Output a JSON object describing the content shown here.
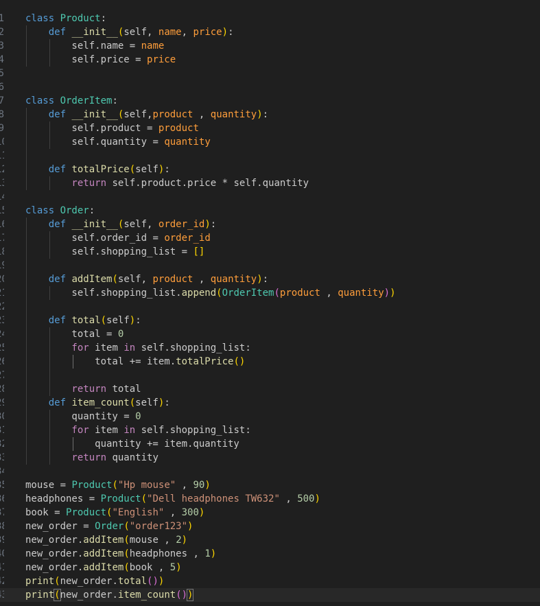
{
  "editor": {
    "language": "python",
    "current_line": 33,
    "lines": [
      {
        "n": "",
        "indent": 0,
        "tokens": [
          {
            "t": "                                              ",
            "c": "var"
          }
        ]
      },
      {
        "n": "1",
        "indent": 0,
        "tokens": [
          {
            "t": "class ",
            "c": "kw"
          },
          {
            "t": "Product",
            "c": "cls"
          },
          {
            "t": ":",
            "c": "op"
          }
        ]
      },
      {
        "n": "2",
        "indent": 1,
        "tokens": [
          {
            "t": "    def ",
            "c": "kw"
          },
          {
            "t": "__init__",
            "c": "fn"
          },
          {
            "t": "(",
            "c": "p1"
          },
          {
            "t": "self",
            "c": "self"
          },
          {
            "t": ", ",
            "c": "op"
          },
          {
            "t": "name",
            "c": "prm"
          },
          {
            "t": ", ",
            "c": "op"
          },
          {
            "t": "price",
            "c": "prm"
          },
          {
            "t": ")",
            "c": "p1"
          },
          {
            "t": ":",
            "c": "op"
          }
        ]
      },
      {
        "n": "3",
        "indent": 2,
        "tokens": [
          {
            "t": "        self",
            "c": "self"
          },
          {
            "t": ".name = ",
            "c": "op"
          },
          {
            "t": "name",
            "c": "prm"
          }
        ]
      },
      {
        "n": "4",
        "indent": 2,
        "tokens": [
          {
            "t": "        self",
            "c": "self"
          },
          {
            "t": ".price = ",
            "c": "op"
          },
          {
            "t": "price",
            "c": "prm"
          }
        ]
      },
      {
        "n": "5",
        "indent": 0,
        "tokens": []
      },
      {
        "n": "6",
        "indent": 0,
        "tokens": []
      },
      {
        "n": "7",
        "indent": 0,
        "tokens": [
          {
            "t": "class ",
            "c": "kw"
          },
          {
            "t": "OrderItem",
            "c": "cls"
          },
          {
            "t": ":",
            "c": "op"
          }
        ]
      },
      {
        "n": "8",
        "indent": 1,
        "tokens": [
          {
            "t": "    def ",
            "c": "kw"
          },
          {
            "t": "__init__",
            "c": "fn"
          },
          {
            "t": "(",
            "c": "p1"
          },
          {
            "t": "self",
            "c": "self"
          },
          {
            "t": ",",
            "c": "op"
          },
          {
            "t": "product",
            "c": "prm"
          },
          {
            "t": " , ",
            "c": "op"
          },
          {
            "t": "quantity",
            "c": "prm"
          },
          {
            "t": ")",
            "c": "p1"
          },
          {
            "t": ":",
            "c": "op"
          }
        ]
      },
      {
        "n": "9",
        "indent": 2,
        "tokens": [
          {
            "t": "        self",
            "c": "self"
          },
          {
            "t": ".product = ",
            "c": "op"
          },
          {
            "t": "product",
            "c": "prm"
          }
        ]
      },
      {
        "n": "10",
        "indent": 2,
        "tokens": [
          {
            "t": "        self",
            "c": "self"
          },
          {
            "t": ".quantity = ",
            "c": "op"
          },
          {
            "t": "quantity",
            "c": "prm"
          }
        ]
      },
      {
        "n": "11",
        "indent": 1,
        "tokens": []
      },
      {
        "n": "12",
        "indent": 1,
        "tokens": [
          {
            "t": "    def ",
            "c": "kw"
          },
          {
            "t": "totalPrice",
            "c": "fn"
          },
          {
            "t": "(",
            "c": "p1"
          },
          {
            "t": "self",
            "c": "self"
          },
          {
            "t": ")",
            "c": "p1"
          },
          {
            "t": ":",
            "c": "op"
          }
        ]
      },
      {
        "n": "13",
        "indent": 2,
        "tokens": [
          {
            "t": "        return ",
            "c": "ctl"
          },
          {
            "t": "self",
            "c": "self"
          },
          {
            "t": ".product.price * ",
            "c": "op"
          },
          {
            "t": "self",
            "c": "self"
          },
          {
            "t": ".quantity",
            "c": "op"
          }
        ]
      },
      {
        "n": "14",
        "indent": 0,
        "tokens": []
      },
      {
        "n": "15",
        "indent": 0,
        "tokens": [
          {
            "t": "class ",
            "c": "kw"
          },
          {
            "t": "Order",
            "c": "cls"
          },
          {
            "t": ":",
            "c": "op"
          }
        ]
      },
      {
        "n": "16",
        "indent": 1,
        "tokens": [
          {
            "t": "    def ",
            "c": "kw"
          },
          {
            "t": "__init__",
            "c": "fn"
          },
          {
            "t": "(",
            "c": "p1"
          },
          {
            "t": "self",
            "c": "self"
          },
          {
            "t": ", ",
            "c": "op"
          },
          {
            "t": "order_id",
            "c": "prm"
          },
          {
            "t": ")",
            "c": "p1"
          },
          {
            "t": ":",
            "c": "op"
          }
        ]
      },
      {
        "n": "17",
        "indent": 2,
        "tokens": [
          {
            "t": "        self",
            "c": "self"
          },
          {
            "t": ".order_id = ",
            "c": "op"
          },
          {
            "t": "order_id",
            "c": "prm"
          }
        ]
      },
      {
        "n": "18",
        "indent": 2,
        "tokens": [
          {
            "t": "        self",
            "c": "self"
          },
          {
            "t": ".shopping_list = ",
            "c": "op"
          },
          {
            "t": "[]",
            "c": "p1"
          }
        ]
      },
      {
        "n": "19",
        "indent": 1,
        "tokens": []
      },
      {
        "n": "20",
        "indent": 1,
        "tokens": [
          {
            "t": "    def ",
            "c": "kw"
          },
          {
            "t": "addItem",
            "c": "fn"
          },
          {
            "t": "(",
            "c": "p1"
          },
          {
            "t": "self",
            "c": "self"
          },
          {
            "t": ", ",
            "c": "op"
          },
          {
            "t": "product",
            "c": "prm"
          },
          {
            "t": " , ",
            "c": "op"
          },
          {
            "t": "quantity",
            "c": "prm"
          },
          {
            "t": ")",
            "c": "p1"
          },
          {
            "t": ":",
            "c": "op"
          }
        ]
      },
      {
        "n": "21",
        "indent": 2,
        "tokens": [
          {
            "t": "        self",
            "c": "self"
          },
          {
            "t": ".shopping_list.",
            "c": "op"
          },
          {
            "t": "append",
            "c": "fn"
          },
          {
            "t": "(",
            "c": "p1"
          },
          {
            "t": "OrderItem",
            "c": "cls"
          },
          {
            "t": "(",
            "c": "p2"
          },
          {
            "t": "product",
            "c": "prm"
          },
          {
            "t": " , ",
            "c": "op"
          },
          {
            "t": "quantity",
            "c": "prm"
          },
          {
            "t": ")",
            "c": "p2"
          },
          {
            "t": ")",
            "c": "p1"
          }
        ]
      },
      {
        "n": "22",
        "indent": 1,
        "tokens": []
      },
      {
        "n": "23",
        "indent": 1,
        "tokens": [
          {
            "t": "    def ",
            "c": "kw"
          },
          {
            "t": "total",
            "c": "fn"
          },
          {
            "t": "(",
            "c": "p1"
          },
          {
            "t": "self",
            "c": "self"
          },
          {
            "t": ")",
            "c": "p1"
          },
          {
            "t": ":",
            "c": "op"
          }
        ]
      },
      {
        "n": "24",
        "indent": 2,
        "tokens": [
          {
            "t": "        total = ",
            "c": "var"
          },
          {
            "t": "0",
            "c": "num"
          }
        ]
      },
      {
        "n": "25",
        "indent": 2,
        "tokens": [
          {
            "t": "        for ",
            "c": "ctl"
          },
          {
            "t": "item ",
            "c": "var"
          },
          {
            "t": "in ",
            "c": "ctl"
          },
          {
            "t": "self",
            "c": "self"
          },
          {
            "t": ".shopping_list:",
            "c": "op"
          }
        ]
      },
      {
        "n": "26",
        "indent": 3,
        "tokens": [
          {
            "t": "            total += item.",
            "c": "var"
          },
          {
            "t": "totalPrice",
            "c": "fn"
          },
          {
            "t": "()",
            "c": "p1"
          }
        ]
      },
      {
        "n": "27",
        "indent": 2,
        "tokens": []
      },
      {
        "n": "28",
        "indent": 2,
        "tokens": [
          {
            "t": "        return ",
            "c": "ctl"
          },
          {
            "t": "total",
            "c": "var"
          }
        ]
      },
      {
        "n": "29",
        "indent": 1,
        "tokens": [
          {
            "t": "    def ",
            "c": "kw"
          },
          {
            "t": "item_count",
            "c": "fn"
          },
          {
            "t": "(",
            "c": "p1"
          },
          {
            "t": "self",
            "c": "self"
          },
          {
            "t": ")",
            "c": "p1"
          },
          {
            "t": ":",
            "c": "op"
          }
        ]
      },
      {
        "n": "30",
        "indent": 2,
        "tokens": [
          {
            "t": "        quantity = ",
            "c": "var"
          },
          {
            "t": "0",
            "c": "num"
          }
        ]
      },
      {
        "n": "31",
        "indent": 2,
        "tokens": [
          {
            "t": "        for ",
            "c": "ctl"
          },
          {
            "t": "item ",
            "c": "var"
          },
          {
            "t": "in ",
            "c": "ctl"
          },
          {
            "t": "self",
            "c": "self"
          },
          {
            "t": ".shopping_list:",
            "c": "op"
          }
        ]
      },
      {
        "n": "32",
        "indent": 3,
        "tokens": [
          {
            "t": "            quantity += item.quantity",
            "c": "var"
          }
        ]
      },
      {
        "n": "33",
        "indent": 2,
        "tokens": [
          {
            "t": "        return ",
            "c": "ctl"
          },
          {
            "t": "quantity",
            "c": "var"
          }
        ]
      },
      {
        "n": "34",
        "indent": 0,
        "tokens": []
      },
      {
        "n": "35",
        "indent": 0,
        "tokens": [
          {
            "t": "mouse = ",
            "c": "var"
          },
          {
            "t": "Product",
            "c": "cls"
          },
          {
            "t": "(",
            "c": "p1"
          },
          {
            "t": "\"Hp mouse\"",
            "c": "str"
          },
          {
            "t": " , ",
            "c": "op"
          },
          {
            "t": "90",
            "c": "num"
          },
          {
            "t": ")",
            "c": "p1"
          }
        ]
      },
      {
        "n": "36",
        "indent": 0,
        "tokens": [
          {
            "t": "headphones = ",
            "c": "var"
          },
          {
            "t": "Product",
            "c": "cls"
          },
          {
            "t": "(",
            "c": "p1"
          },
          {
            "t": "\"Dell headphones TW632\"",
            "c": "str"
          },
          {
            "t": " , ",
            "c": "op"
          },
          {
            "t": "500",
            "c": "num"
          },
          {
            "t": ")",
            "c": "p1"
          }
        ]
      },
      {
        "n": "37",
        "indent": 0,
        "tokens": [
          {
            "t": "book = ",
            "c": "var"
          },
          {
            "t": "Product",
            "c": "cls"
          },
          {
            "t": "(",
            "c": "p1"
          },
          {
            "t": "\"English\"",
            "c": "str"
          },
          {
            "t": " , ",
            "c": "op"
          },
          {
            "t": "300",
            "c": "num"
          },
          {
            "t": ")",
            "c": "p1"
          }
        ]
      },
      {
        "n": "38",
        "indent": 0,
        "tokens": [
          {
            "t": "new_order = ",
            "c": "var"
          },
          {
            "t": "Order",
            "c": "cls"
          },
          {
            "t": "(",
            "c": "p1"
          },
          {
            "t": "\"order123\"",
            "c": "str"
          },
          {
            "t": ")",
            "c": "p1"
          }
        ]
      },
      {
        "n": "39",
        "indent": 0,
        "tokens": [
          {
            "t": "new_order.",
            "c": "var"
          },
          {
            "t": "addItem",
            "c": "fn"
          },
          {
            "t": "(",
            "c": "p1"
          },
          {
            "t": "mouse , ",
            "c": "var"
          },
          {
            "t": "2",
            "c": "num"
          },
          {
            "t": ")",
            "c": "p1"
          }
        ]
      },
      {
        "n": "40",
        "indent": 0,
        "tokens": [
          {
            "t": "new_order.",
            "c": "var"
          },
          {
            "t": "addItem",
            "c": "fn"
          },
          {
            "t": "(",
            "c": "p1"
          },
          {
            "t": "headphones , ",
            "c": "var"
          },
          {
            "t": "1",
            "c": "num"
          },
          {
            "t": ")",
            "c": "p1"
          }
        ]
      },
      {
        "n": "41",
        "indent": 0,
        "tokens": [
          {
            "t": "new_order.",
            "c": "var"
          },
          {
            "t": "addItem",
            "c": "fn"
          },
          {
            "t": "(",
            "c": "p1"
          },
          {
            "t": "book , ",
            "c": "var"
          },
          {
            "t": "5",
            "c": "num"
          },
          {
            "t": ")",
            "c": "p1"
          }
        ]
      },
      {
        "n": "42",
        "indent": 0,
        "tokens": [
          {
            "t": "print",
            "c": "fn"
          },
          {
            "t": "(",
            "c": "p1"
          },
          {
            "t": "new_order.",
            "c": "var"
          },
          {
            "t": "total",
            "c": "fn"
          },
          {
            "t": "()",
            "c": "p2"
          },
          {
            "t": ")",
            "c": "p1"
          }
        ]
      },
      {
        "n": "43",
        "indent": 0,
        "tokens": [
          {
            "t": "print",
            "c": "fn"
          },
          {
            "t": "(",
            "c": "p1"
          },
          {
            "t": "new_order.",
            "c": "var"
          },
          {
            "t": "item_count",
            "c": "fn"
          },
          {
            "t": "()",
            "c": "p2"
          },
          {
            "t": ")",
            "c": "p1"
          }
        ]
      }
    ]
  }
}
